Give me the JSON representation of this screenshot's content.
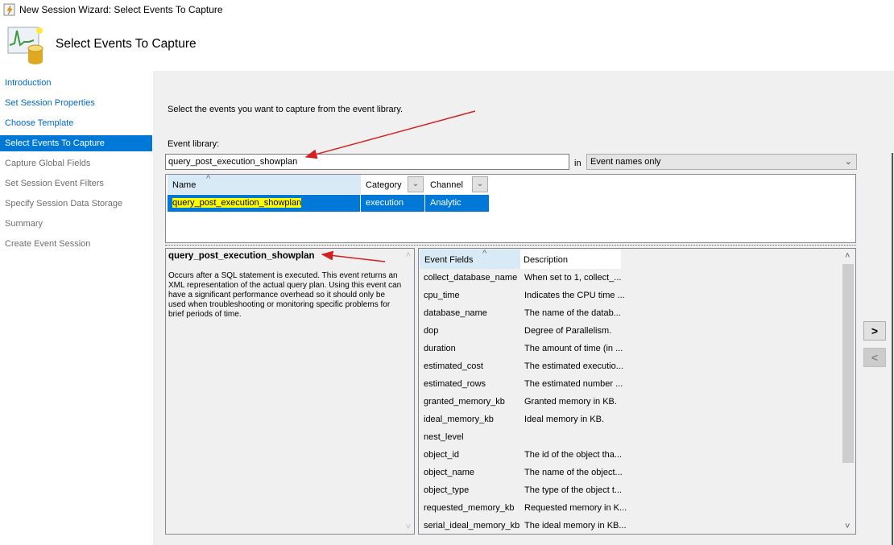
{
  "window": {
    "title": "New Session Wizard: Select Events To Capture"
  },
  "header": {
    "title": "Select Events To Capture"
  },
  "sidebar": {
    "items": [
      {
        "label": "Introduction",
        "state": "link"
      },
      {
        "label": "Set Session Properties",
        "state": "link"
      },
      {
        "label": "Choose Template",
        "state": "link"
      },
      {
        "label": "Select Events To Capture",
        "state": "selected"
      },
      {
        "label": "Capture Global Fields",
        "state": "disabled"
      },
      {
        "label": "Set Session Event Filters",
        "state": "disabled"
      },
      {
        "label": "Specify Session Data Storage",
        "state": "disabled"
      },
      {
        "label": "Summary",
        "state": "disabled"
      },
      {
        "label": "Create Event Session",
        "state": "disabled"
      }
    ]
  },
  "main": {
    "instruction": "Select the events you want to capture from the event library.",
    "library_label": "Event library:",
    "search_value": "query_post_execution_showplan",
    "in_label": "in",
    "scope_select": "Event names only",
    "columns": {
      "name": "Name",
      "category": "Category",
      "channel": "Channel"
    },
    "results": [
      {
        "name": "query_post_execution_showplan",
        "category": "execution",
        "channel": "Analytic"
      }
    ],
    "detail": {
      "title": "query_post_execution_showplan",
      "description": "Occurs after a SQL statement is executed. This event returns an XML representation of the actual query plan. Using this event can have a significant performance overhead so it should only be used when troubleshooting or monitoring specific problems for brief periods of time."
    },
    "fields_columns": {
      "field": "Event Fields",
      "description": "Description"
    },
    "fields": [
      {
        "name": "collect_database_name",
        "desc": "When set to 1, collect_..."
      },
      {
        "name": "cpu_time",
        "desc": "Indicates the CPU time ..."
      },
      {
        "name": "database_name",
        "desc": "The name of the datab..."
      },
      {
        "name": "dop",
        "desc": "Degree of Parallelism."
      },
      {
        "name": "duration",
        "desc": "The amount of time (in ..."
      },
      {
        "name": "estimated_cost",
        "desc": "The estimated executio..."
      },
      {
        "name": "estimated_rows",
        "desc": "The estimated number ..."
      },
      {
        "name": "granted_memory_kb",
        "desc": "Granted memory in KB."
      },
      {
        "name": "ideal_memory_kb",
        "desc": "Ideal memory in KB."
      },
      {
        "name": "nest_level",
        "desc": ""
      },
      {
        "name": "object_id",
        "desc": "The id of the object tha..."
      },
      {
        "name": "object_name",
        "desc": "The name of the object..."
      },
      {
        "name": "object_type",
        "desc": "The type of the object t..."
      },
      {
        "name": "requested_memory_kb",
        "desc": "Requested memory in K..."
      },
      {
        "name": "serial_ideal_memory_kb",
        "desc": "The ideal memory in KB..."
      }
    ],
    "add_button": ">",
    "remove_button": "<"
  }
}
